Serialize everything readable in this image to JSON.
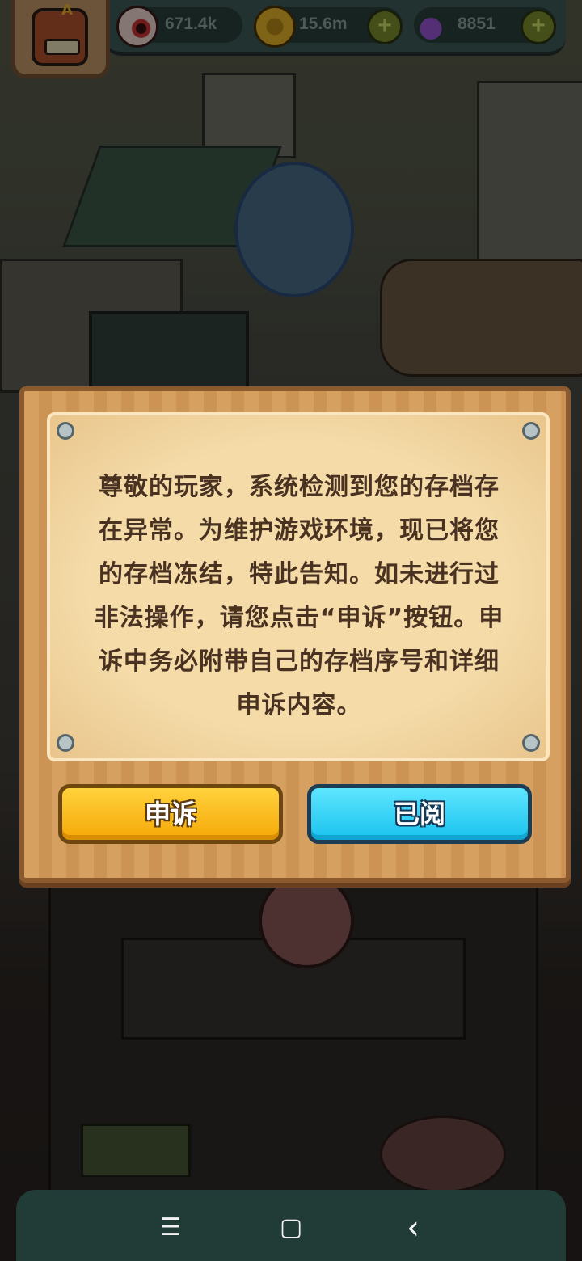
{
  "resources": [
    {
      "name": "eyeball",
      "icon": "eyeball-icon",
      "value": "671.4k"
    },
    {
      "name": "coins",
      "icon": "coin-icon",
      "value": "15.6m"
    },
    {
      "name": "potion",
      "icon": "potion-icon",
      "value": "8851"
    }
  ],
  "plus_label": "+",
  "dialog": {
    "message": "尊敬的玩家，系统检测到您的存档存在异常。为维护游戏环境，现已将您的存档冻结，特此告知。如未进行过非法操作，请您点击“申诉”按钮。申诉中务必附带自己的存档序号和详细申诉内容。",
    "appeal_label": "申诉",
    "read_label": "已阅"
  },
  "navbar": {
    "menu": "☰",
    "home": "▢",
    "back": "‹"
  },
  "colors": {
    "appeal": "#f5a806",
    "read": "#18c2ee",
    "panel": "#d39a58",
    "paper": "#f3d8a6"
  }
}
